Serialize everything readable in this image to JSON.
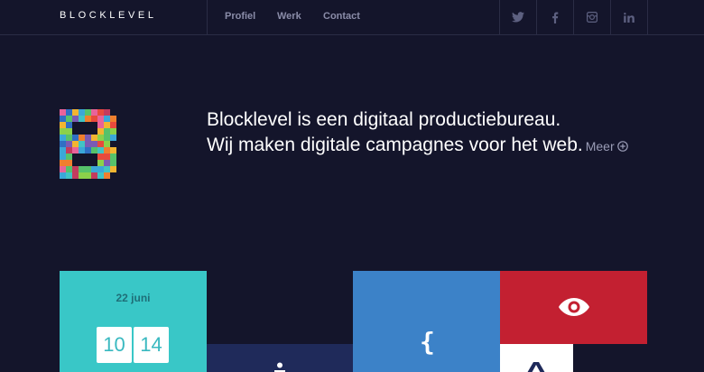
{
  "header": {
    "logo": "BLOCKLEVEL",
    "nav": [
      "Profiel",
      "Werk",
      "Contact"
    ],
    "social": [
      "twitter-icon",
      "facebook-icon",
      "instagram-icon",
      "linkedin-icon"
    ]
  },
  "hero": {
    "line1": "Blocklevel is een digitaal productiebureau.",
    "line2": "Wij maken digitale campagnes voor het web.",
    "more": "Meer"
  },
  "tiles": {
    "calendar": {
      "date": "22 juni",
      "hour": "10",
      "minute": "14"
    },
    "code_symbol": "{"
  },
  "colors": {
    "background": "#14152b",
    "teal": "#39c7c7",
    "navy": "#1f2a5a",
    "blue": "#3c82c8",
    "red": "#c32031"
  }
}
